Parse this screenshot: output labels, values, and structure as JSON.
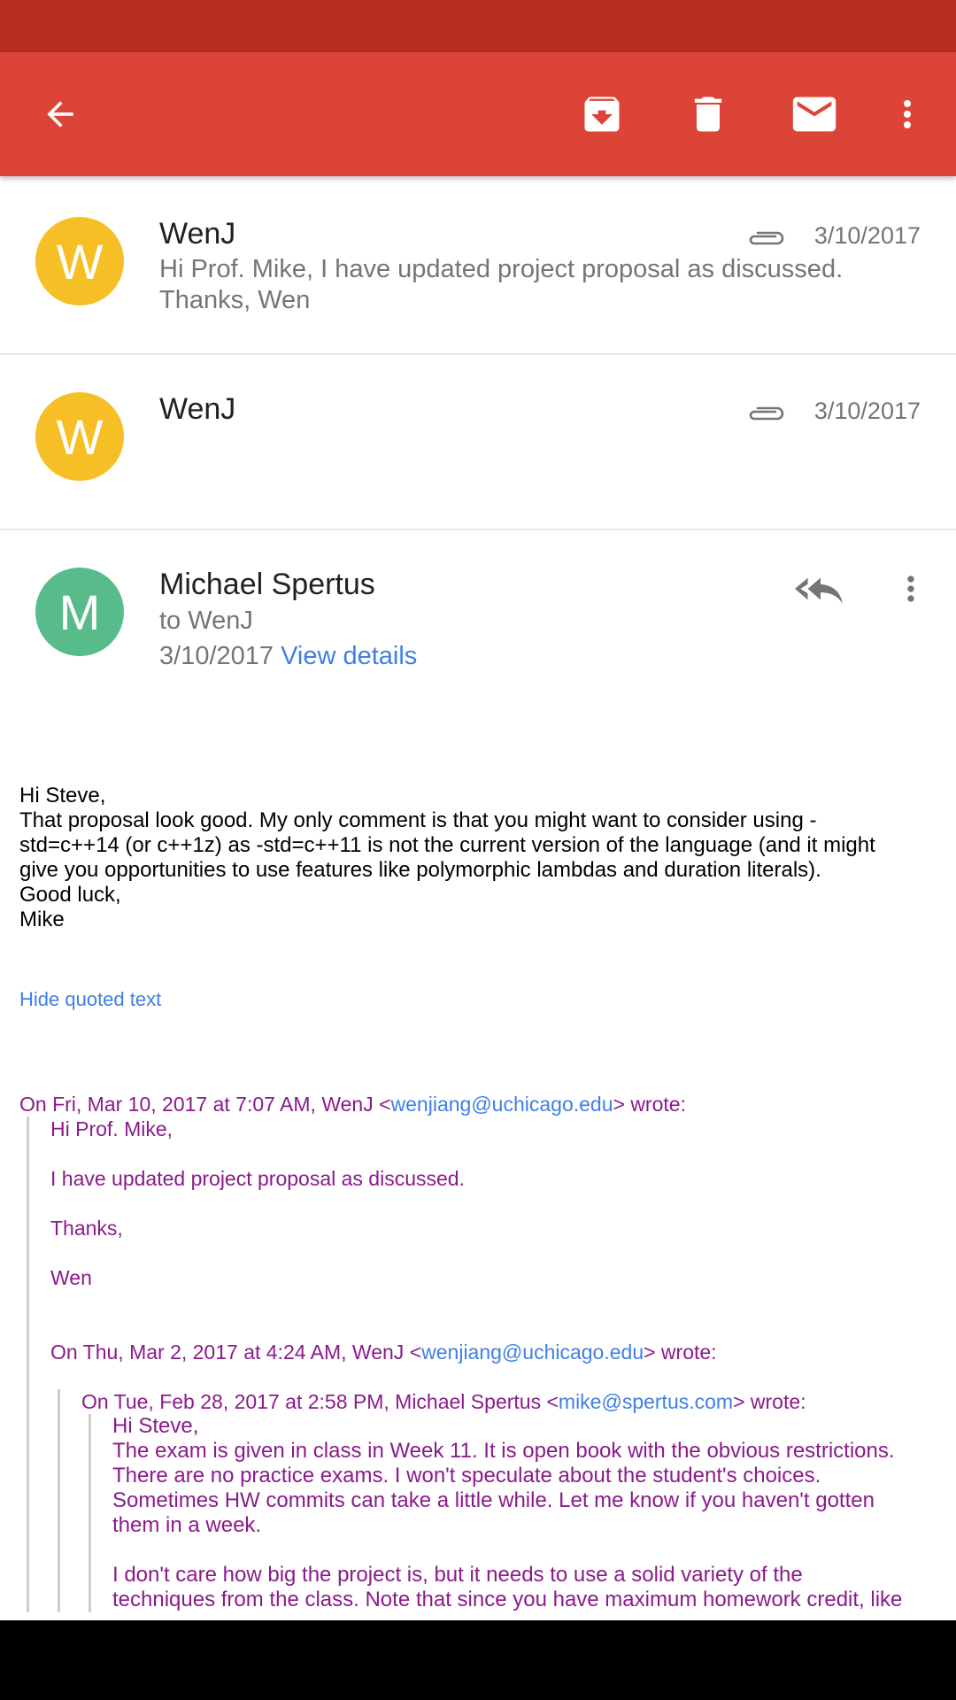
{
  "app_bar": {
    "back_icon": "arrow-back-icon",
    "archive_icon": "archive-icon",
    "delete_icon": "trash-icon",
    "unread_icon": "mail-icon",
    "more_icon": "more-vert-icon"
  },
  "messages": [
    {
      "sender": "WenJ",
      "avatar_letter": "W",
      "avatar_color": "#f6bf26",
      "date": "3/10/2017",
      "snippet": "Hi Prof. Mike, I have updated project proposal as discussed. Thanks, Wen",
      "has_attachment": true
    },
    {
      "sender": "WenJ",
      "avatar_letter": "W",
      "avatar_color": "#f6bf26",
      "date": "3/10/2017",
      "snippet": "",
      "has_attachment": true
    }
  ],
  "open_message": {
    "sender": "Michael Spertus",
    "avatar_letter": "M",
    "avatar_color": "#57bb8a",
    "recipient": "to WenJ",
    "date": "3/10/2017",
    "view_details": "View details",
    "body_lines": [
      "Hi Steve,",
      "That proposal look good. My only comment is that you might want to consider using -",
      "std=c++14 (or c++1z) as -std=c++11 is not the current version of the language (and it might",
      "give you opportunities to use features like polymorphic lambdas and duration literals).",
      "Good luck,",
      "Mike"
    ],
    "hide_quoted": "Hide quoted text",
    "quote1": {
      "header_pre": "On Fri, Mar 10, 2017 at 7:07 AM, WenJ <",
      "email": "wenjiang@uchicago.edu",
      "header_post": "> wrote:",
      "line1": "Hi Prof. Mike,",
      "line2": "I have updated project proposal as discussed.",
      "line3": "Thanks,",
      "line4": "Wen"
    },
    "quote2": {
      "header_pre": "On Thu, Mar 2, 2017 at 4:24 AM, WenJ <",
      "email": "wenjiang@uchicago.edu",
      "header_post": "> wrote:"
    },
    "quote3": {
      "header_pre": "On Tue, Feb 28, 2017 at 2:58 PM, Michael Spertus <",
      "email": "mike@spertus.com",
      "header_post": "> wrote:",
      "lines": [
        "Hi Steve,",
        "The  exam is given in class in Week 11. It is open book with the obvious restrictions.",
        "There are no practice exams. I won't speculate about the student's choices.",
        "Sometimes HW  commits can take a little while. Let me know if you haven't gotten",
        "them in a week.",
        "",
        "I don't care how big the project is, but it needs to use a solid variety of the",
        "techniques from the class. Note that since you have maximum homework credit, like"
      ]
    }
  }
}
